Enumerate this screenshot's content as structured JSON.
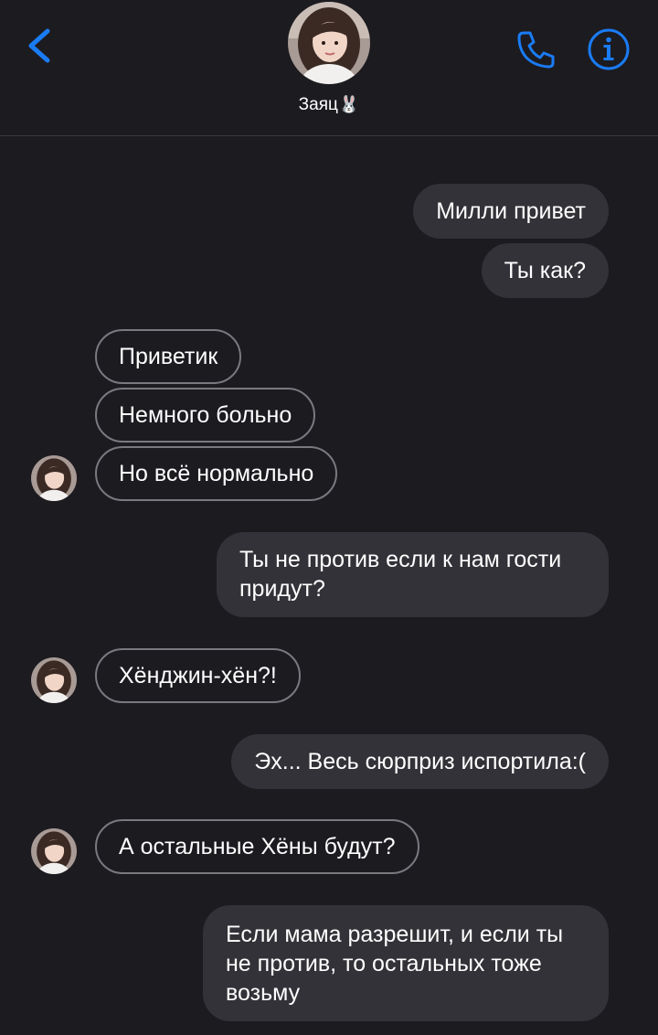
{
  "header": {
    "contact_name": "Заяц",
    "contact_emoji": "🐰",
    "back_icon": "chevron-left-icon",
    "call_icon": "phone-icon",
    "info_icon": "info-icon"
  },
  "colors": {
    "background": "#1c1b20",
    "accent": "#1a7cf5",
    "outgoing_bubble": "#333238",
    "incoming_border": "#7a797f"
  },
  "messages": [
    {
      "direction": "outgoing",
      "text": "Милли привет"
    },
    {
      "direction": "outgoing",
      "text": "Ты как?"
    },
    {
      "direction": "incoming",
      "text": "Приветик"
    },
    {
      "direction": "incoming",
      "text": "Немного больно"
    },
    {
      "direction": "incoming",
      "text": "Но всё нормально"
    },
    {
      "direction": "outgoing",
      "text": "Ты не против если к нам гости придут?"
    },
    {
      "direction": "incoming",
      "text": "Хёнджин-хён?!"
    },
    {
      "direction": "outgoing",
      "text": "Эх... Весь сюрприз испортила:("
    },
    {
      "direction": "incoming",
      "text": "А остальные Хёны будут?"
    },
    {
      "direction": "outgoing",
      "text": "Если мама разрешит, и если ты не против, то остальных тоже возьму"
    }
  ]
}
